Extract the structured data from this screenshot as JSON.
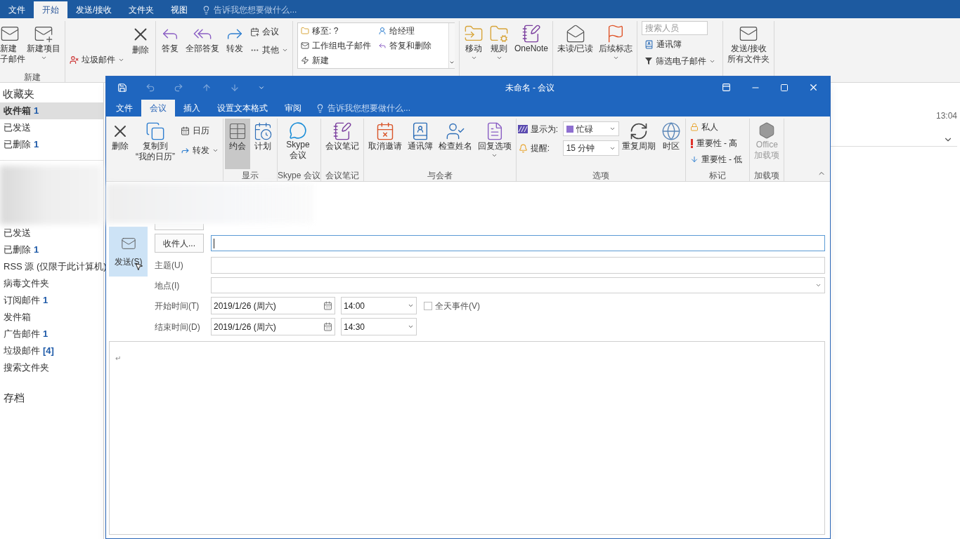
{
  "main_window": {
    "tabs": [
      {
        "label": "文件",
        "selected": false
      },
      {
        "label": "开始",
        "selected": true
      },
      {
        "label": "发送/接收",
        "selected": false
      },
      {
        "label": "文件夹",
        "selected": false
      },
      {
        "label": "视图",
        "selected": false
      }
    ],
    "tell_me": "告诉我您想要做什么...",
    "ribbon": {
      "new": {
        "new_email": [
          "新建",
          "子邮件"
        ],
        "new_items": "新建项目",
        "label": "新建"
      },
      "delete": {
        "junk": "垃圾邮件",
        "delete": "删除"
      },
      "respond": {
        "reply": "答复",
        "reply_all": "全部答复",
        "forward": "转发",
        "meeting": "会议",
        "more": "其他"
      },
      "quick_steps": [
        {
          "label": "移至: ?"
        },
        {
          "label": "给经理"
        },
        {
          "label": "工作组电子邮件"
        },
        {
          "label": "答复和删除"
        },
        {
          "label": "新建"
        }
      ],
      "move": {
        "move": "移动",
        "rules": "规则",
        "onenote": "OneNote"
      },
      "tags": {
        "unread": "未读/已读",
        "flag": "后续标志"
      },
      "find": {
        "search_placeholder": "搜索人员",
        "address_book": "通讯簿",
        "filter": "筛选电子邮件"
      },
      "send_receive": [
        "发送/接收",
        "所有文件夹"
      ]
    },
    "favorites": {
      "title": "收藏夹",
      "items": [
        {
          "label": "收件箱",
          "count": "1",
          "selected": true
        },
        {
          "label": "已发送",
          "selected": false
        },
        {
          "label": "已删除",
          "count": "1",
          "selected": false
        }
      ]
    },
    "folders": [
      {
        "label": "已发送",
        "selected": false
      },
      {
        "label": "已删除",
        "count": "1",
        "selected": false
      },
      {
        "label": "RSS 源 (仅限于此计算机)",
        "selected": false
      },
      {
        "label": "病毒文件夹",
        "selected": false
      },
      {
        "label": "订阅邮件",
        "count": "1",
        "selected": false
      },
      {
        "label": "发件箱",
        "selected": false
      },
      {
        "label": "广告邮件",
        "count": "1",
        "selected": false
      },
      {
        "label": "垃圾邮件",
        "count": "[4]",
        "selected": false
      },
      {
        "label": "搜索文件夹",
        "selected": false
      }
    ],
    "archive": "存档",
    "message_time": "13:04"
  },
  "meeting_window": {
    "title": "未命名 - 会议",
    "tabs": [
      {
        "label": "文件",
        "selected": false
      },
      {
        "label": "会议",
        "selected": true
      },
      {
        "label": "插入",
        "selected": false
      },
      {
        "label": "设置文本格式",
        "selected": false
      },
      {
        "label": "审阅",
        "selected": false
      }
    ],
    "tell_me": "告诉我您想要做什么...",
    "ribbon": {
      "actions": {
        "delete": "删除",
        "copy": [
          "复制到",
          "“我的日历”"
        ],
        "calendar": "日历",
        "forward": "转发"
      },
      "show": {
        "label": "显示",
        "buttons": [
          {
            "label": "约会",
            "selected": true
          },
          {
            "label": "计划",
            "selected": false
          }
        ]
      },
      "skype": {
        "label": "Skype 会议",
        "button": [
          "Skype",
          "会议"
        ]
      },
      "notes": {
        "label": "会议笔记",
        "button": "会议笔记"
      },
      "attendees": {
        "label": "与会者",
        "cancel": "取消邀请",
        "address_book": "通讯簿",
        "check_names": "检查姓名",
        "response": "回复选项"
      },
      "options": {
        "label": "选项",
        "show_as_label": "显示为:",
        "show_as": "忙碌",
        "reminder_label": "提醒:",
        "reminder": "15 分钟",
        "recurrence": "重复周期",
        "time_zone": "时区"
      },
      "tags": {
        "label": "标记",
        "private": "私人",
        "high": "重要性 - 高",
        "low": "重要性 - 低"
      },
      "addins": {
        "label": "加载项",
        "button": [
          "Office",
          "加载项"
        ],
        "disabled": true
      }
    },
    "form": {
      "send": "发送(S)",
      "to_button": "收件人...",
      "to_focused": true,
      "subject_label": "主题(U)",
      "location_label": "地点(I)",
      "start": {
        "label": "开始时间(T)",
        "date": "2019/1/26 (周六)",
        "time": "14:00"
      },
      "end": {
        "label": "结束时间(D)",
        "date": "2019/1/26 (周六)",
        "time": "14:30"
      },
      "all_day": {
        "label": "全天事件(V)",
        "checked": false
      },
      "body": "↵"
    }
  }
}
